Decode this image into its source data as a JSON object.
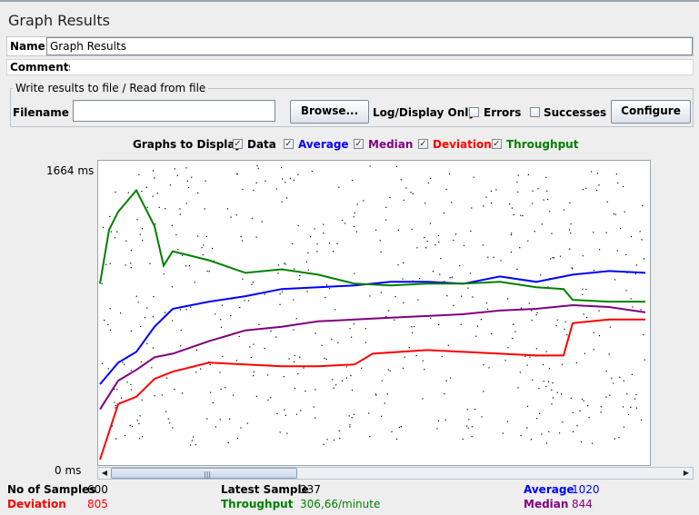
{
  "window": {
    "title": "Graph Results"
  },
  "form": {
    "name_label": "Name:",
    "name_value": "Graph Results",
    "comments_label": "Comments:",
    "comments_value": ""
  },
  "file_group": {
    "title": "Write results to file / Read from file",
    "filename_label": "Filename",
    "filename_value": "",
    "browse_label": "Browse...",
    "log_display_label": "Log/Display Only:",
    "errors_label": "Errors",
    "errors_checked": false,
    "successes_label": "Successes",
    "successes_checked": false,
    "configure_label": "Configure"
  },
  "graphs_to_display": {
    "label": "Graphs to Display",
    "checkmark": "✓",
    "options": [
      {
        "label": "Data",
        "checked": true,
        "color": "#000000"
      },
      {
        "label": "Average",
        "checked": true,
        "color": "#0000ff"
      },
      {
        "label": "Median",
        "checked": true,
        "color": "#800080"
      },
      {
        "label": "Deviation",
        "checked": true,
        "color": "#ff0000"
      },
      {
        "label": "Throughput",
        "checked": true,
        "color": "#008000"
      }
    ]
  },
  "graph": {
    "y_max_label": "1664  ms",
    "y_min_label": "0  ms"
  },
  "chart_data": {
    "type": "scatter",
    "y_unit": "ms",
    "ylim": [
      0,
      1664
    ],
    "x_range_samples": [
      0,
      600
    ],
    "series": [
      {
        "name": "Average",
        "color": "#0000ff",
        "x": [
          0,
          20,
          40,
          60,
          80,
          120,
          160,
          200,
          240,
          280,
          320,
          360,
          400,
          440,
          480,
          520,
          560,
          600
        ],
        "y": [
          440,
          560,
          620,
          760,
          860,
          900,
          930,
          970,
          980,
          990,
          1010,
          1010,
          1000,
          1040,
          1010,
          1050,
          1070,
          1060
        ]
      },
      {
        "name": "Median",
        "color": "#800080",
        "x": [
          0,
          20,
          40,
          60,
          80,
          120,
          160,
          200,
          240,
          280,
          320,
          360,
          400,
          440,
          480,
          520,
          560,
          600
        ],
        "y": [
          300,
          460,
          520,
          590,
          610,
          680,
          740,
          760,
          790,
          800,
          810,
          820,
          830,
          850,
          860,
          880,
          870,
          840
        ]
      },
      {
        "name": "Deviation",
        "color": "#ff0000",
        "x": [
          0,
          20,
          40,
          60,
          80,
          120,
          160,
          200,
          240,
          280,
          300,
          360,
          400,
          440,
          480,
          510,
          520,
          560,
          600
        ],
        "y": [
          20,
          330,
          370,
          470,
          510,
          560,
          550,
          540,
          540,
          550,
          610,
          630,
          620,
          610,
          600,
          600,
          780,
          800,
          800
        ]
      },
      {
        "name": "Throughput",
        "color": "#008000",
        "x": [
          0,
          10,
          20,
          40,
          60,
          70,
          80,
          120,
          160,
          200,
          240,
          280,
          320,
          360,
          400,
          440,
          480,
          510,
          520,
          560,
          600
        ],
        "y": [
          1000,
          1300,
          1400,
          1520,
          1320,
          1100,
          1180,
          1130,
          1060,
          1080,
          1050,
          1000,
          990,
          1000,
          1000,
          1010,
          980,
          970,
          910,
          900,
          900
        ]
      }
    ],
    "data_point_count": 600
  },
  "stats": {
    "samples_label": "No of Samples",
    "samples_value": "600",
    "latest_label": "Latest Sample",
    "latest_value": "337",
    "average_label": "Average",
    "average_value": "1020",
    "deviation_label": "Deviation",
    "deviation_value": "805",
    "throughput_label": "Throughput",
    "throughput_value": "306,66/minute",
    "median_label": "Median",
    "median_value": "844"
  },
  "colors": {
    "average": "#0000ff",
    "median": "#800080",
    "deviation": "#ff0000",
    "throughput": "#008000",
    "data": "#000000"
  }
}
